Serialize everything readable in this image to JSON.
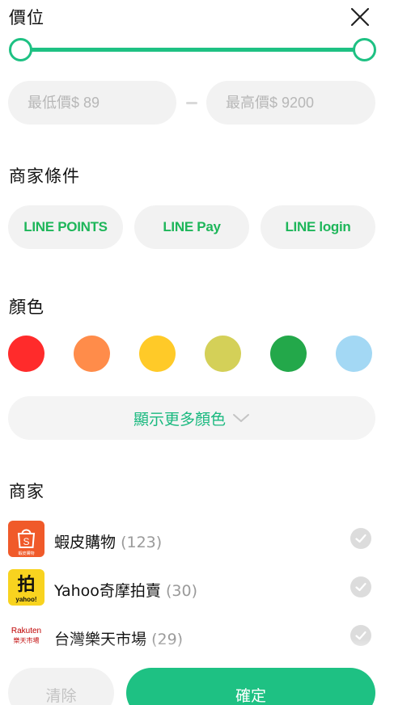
{
  "price": {
    "title": "價位",
    "min_placeholder": "最低價$ 89",
    "max_placeholder": "最高價$ 9200",
    "range_min_fraction": 0,
    "range_max_fraction": 1
  },
  "conditions": {
    "title": "商家條件",
    "pills": [
      {
        "label": "LINE POINTS"
      },
      {
        "label": "LINE Pay"
      },
      {
        "label": "LINE login"
      }
    ]
  },
  "colors": {
    "title": "顏色",
    "swatches": [
      {
        "name": "red",
        "hex": "#ff2b2b"
      },
      {
        "name": "orange",
        "hex": "#ff8c4a"
      },
      {
        "name": "yellow",
        "hex": "#ffca28"
      },
      {
        "name": "olive-yellow",
        "hex": "#d4d058"
      },
      {
        "name": "green",
        "hex": "#23a84a"
      },
      {
        "name": "light-blue",
        "hex": "#a3d8f4"
      }
    ],
    "more_label": "顯示更多顏色"
  },
  "merchants": {
    "title": "商家",
    "items": [
      {
        "name": "蝦皮購物",
        "count": "(123)",
        "logo": "shopee-logo",
        "logo_text": "S",
        "logo_subtext": "蝦皮購物"
      },
      {
        "name": "Yahoo奇摩拍賣",
        "count": "(30)",
        "logo": "yahoo-auction-logo",
        "logo_text": "拍",
        "logo_subtext": "yahoo!"
      },
      {
        "name": "台灣樂天市場",
        "count": "(29)",
        "logo": "rakuten-logo",
        "logo_text": "Rakuten",
        "logo_subtext": "樂天市場"
      }
    ]
  },
  "footer": {
    "clear_label": "清除",
    "confirm_label": "確定"
  },
  "theme": {
    "accent": "#1ec183",
    "line_green": "#1eb65a"
  }
}
